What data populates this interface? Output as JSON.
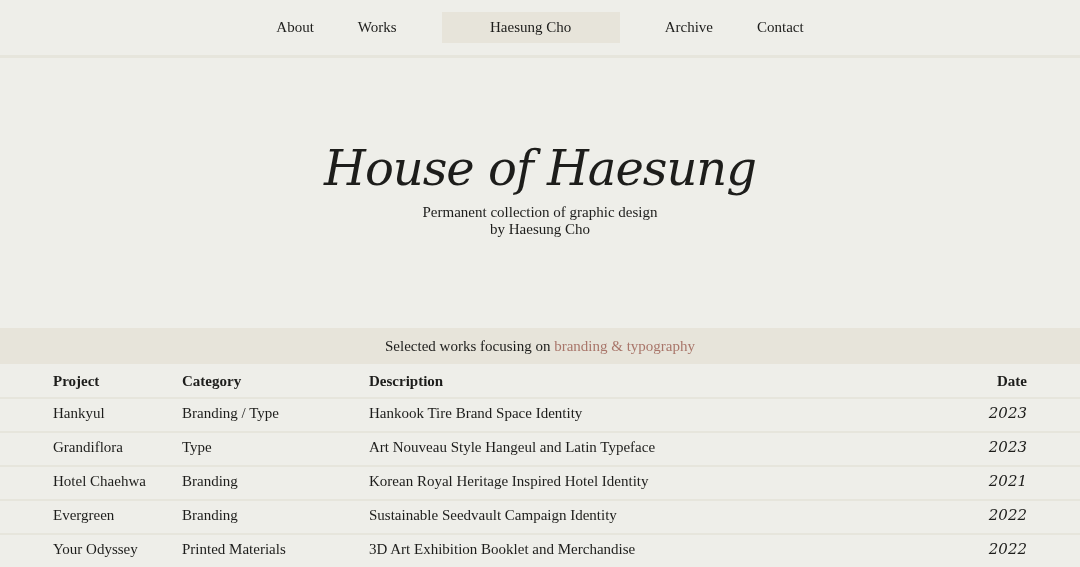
{
  "nav": [
    {
      "label": "About",
      "selected": false
    },
    {
      "label": "Works",
      "selected": false
    },
    {
      "label": "Haesung Cho",
      "selected": true
    },
    {
      "label": "Archive",
      "selected": false
    },
    {
      "label": "Contact",
      "selected": false
    }
  ],
  "hero": {
    "title": "House of Haesung",
    "subtitle": [
      "Permanent collection of graphic design",
      "by Haesung Cho"
    ]
  },
  "banner": {
    "text": "Selected works focusing on",
    "highlight": "branding & typography"
  },
  "table": {
    "columns": [
      "Project",
      "Category",
      "Description",
      "Date"
    ],
    "rows": [
      [
        "Hankyul",
        "Branding / Type",
        "Hankook Tire Brand Space Identity",
        "2023"
      ],
      [
        "Grandiflora",
        "Type",
        "Art Nouveau Style Hangeul and Latin Typeface",
        "2023"
      ],
      [
        "Hotel Chaehwa",
        "Branding",
        "Korean Royal Heritage Inspired Hotel Identity",
        "2021"
      ],
      [
        "Evergreen",
        "Branding",
        "Sustainable Seedvault Campaign Identity",
        "2022"
      ],
      [
        "Your Odyssey",
        "Printed Materials",
        "3D Art Exhibition Booklet and Merchandise",
        "2022"
      ]
    ]
  }
}
